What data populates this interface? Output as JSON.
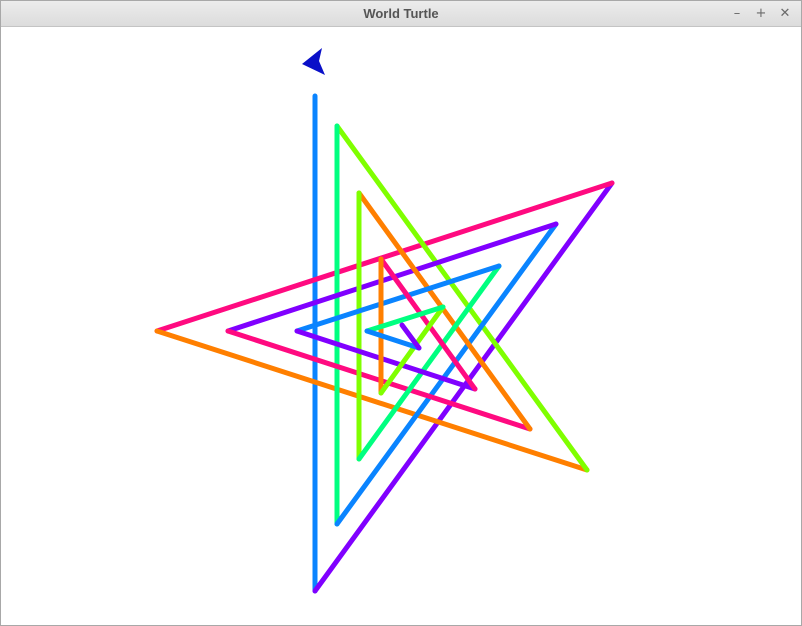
{
  "window": {
    "title": "World Turtle",
    "controls": {
      "minimize_glyph": "–",
      "maximize_glyph": "+",
      "close_glyph": "✕"
    }
  },
  "turtle": {
    "color": "#0a10c8",
    "icon": "turtle-arrow-icon"
  },
  "palette": [
    "#0a84ff",
    "#7fff00",
    "#ff0a80",
    "#8000ff",
    "#ff7f00",
    "#00ff80"
  ]
}
